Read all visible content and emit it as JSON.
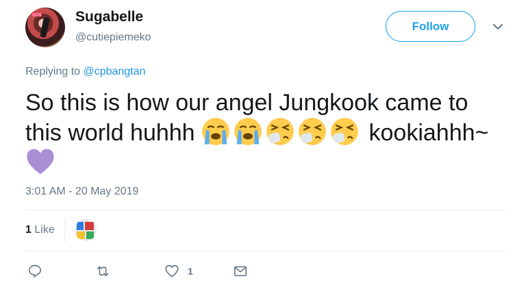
{
  "user": {
    "display_name": "Sugabelle",
    "handle": "@cutiepiemeko"
  },
  "header": {
    "follow_label": "Follow"
  },
  "reply": {
    "prefix": "Replying to",
    "mention": "@cpbangtan"
  },
  "tweet": {
    "text_line1": "So this is how our angel Jungkook came to",
    "text_line2_start": "this world huhhh",
    "text_after_emoji": "kookiahhh~",
    "emojis": [
      "loudly-crying-face-icon",
      "loudly-crying-face-icon",
      "sneezing-face-icon",
      "sneezing-face-icon",
      "sneezing-face-icon"
    ],
    "end_emoji": "purple-heart-icon",
    "timestamp": "3:01 AM - 20 May 2019"
  },
  "stats": {
    "like_count": "1",
    "like_label": "Like"
  },
  "actions": {
    "reply_icon": "reply-icon",
    "retweet_icon": "retweet-icon",
    "like_icon": "heart-outline-icon",
    "like_count": "1",
    "dm_icon": "envelope-icon"
  },
  "colors": {
    "accent": "#1da1f2",
    "mention": "#1b95e0",
    "muted": "#657786",
    "divider": "#e6ecf0",
    "heart_purple": "#aa8ed6",
    "emoji_yellow": "#ffcc4d",
    "tear_blue": "#5dadec"
  }
}
